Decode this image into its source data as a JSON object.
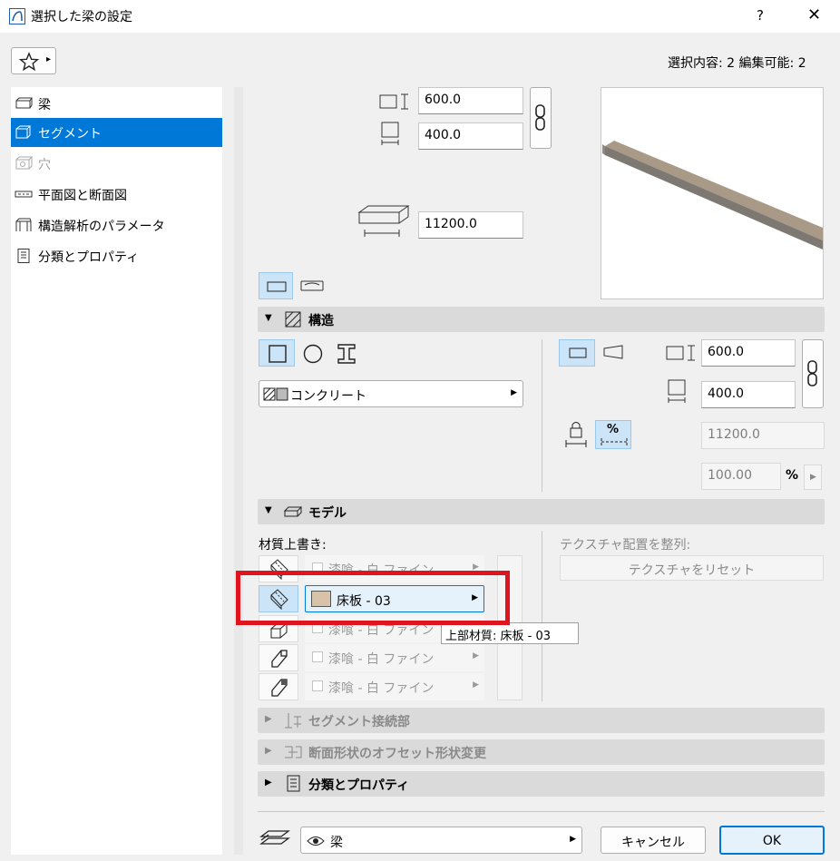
{
  "window": {
    "title": "選択した梁の設定",
    "help": "?",
    "close": "✕"
  },
  "header": {
    "selection_info": "選択内容: 2 編集可能: 2",
    "favorites_arrow": "▸"
  },
  "nav": {
    "items": [
      {
        "label": "梁",
        "state": "normal"
      },
      {
        "label": "セグメント",
        "state": "selected"
      },
      {
        "label": "穴",
        "state": "disabled"
      },
      {
        "label": "平面図と断面図",
        "state": "normal"
      },
      {
        "label": "構造解析のパラメータ",
        "state": "normal"
      },
      {
        "label": "分類とプロパティ",
        "state": "normal"
      }
    ]
  },
  "geometry": {
    "height": "600.0",
    "width": "400.0",
    "length": "11200.0"
  },
  "structure": {
    "title": "構造",
    "material": "コンクリート",
    "height": "600.0",
    "width": "400.0",
    "length_ro": "11200.0",
    "percent_value": "100.00",
    "percent_unit": "%",
    "percent_icon": "%"
  },
  "model": {
    "title": "モデル",
    "override_label": "材質上書き:",
    "texture_label": "テクスチャ配置を整列:",
    "texture_reset": "テクスチャをリセット",
    "materials": [
      {
        "label": "漆喰 - 白 ファイン",
        "active": false
      },
      {
        "label": "床板 - 03",
        "active": true,
        "swatch": "#d8c3aa"
      },
      {
        "label": "漆喰 - 白 ファイン",
        "active": false
      },
      {
        "label": "漆喰 - 白 ファイン",
        "active": false
      },
      {
        "label": "漆喰 - 白 ファイン",
        "active": false
      }
    ],
    "tooltip": "上部材質: 床板 - 03"
  },
  "sections": {
    "segment_joint": "セグメント接続部",
    "profile_offset": "断面形状のオフセット形状変更",
    "classification": "分類とプロパティ"
  },
  "footer": {
    "layer": "梁",
    "cancel": "キャンセル",
    "ok": "OK"
  },
  "colors": {
    "accent": "#0078d7",
    "highlight_red": "#e0141e",
    "select_bg": "#cce4f7"
  }
}
